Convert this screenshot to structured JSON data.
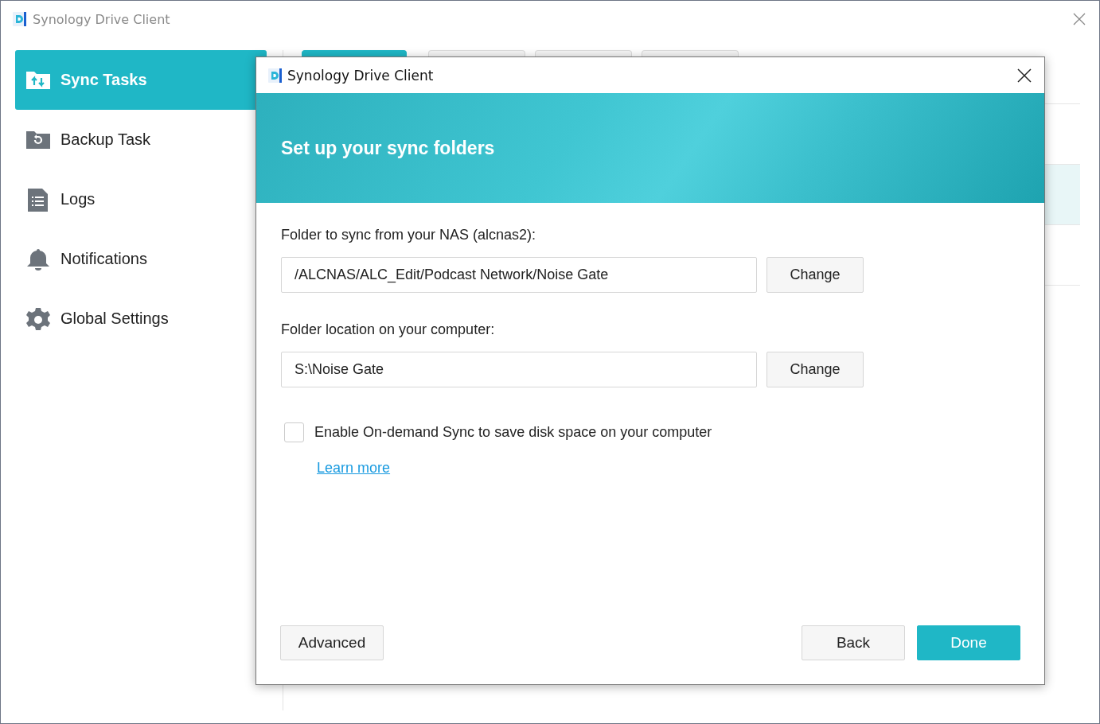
{
  "window": {
    "title": "Synology Drive Client"
  },
  "sidebar": {
    "items": [
      {
        "label": "Sync Tasks",
        "kind": "sync",
        "selected": true
      },
      {
        "label": "Backup Task",
        "kind": "backup",
        "selected": false
      },
      {
        "label": "Logs",
        "kind": "logs",
        "selected": false
      },
      {
        "label": "Notifications",
        "kind": "notifications",
        "selected": false
      },
      {
        "label": "Global Settings",
        "kind": "settings",
        "selected": false
      }
    ]
  },
  "background_tabs": [
    {
      "selected": true
    },
    {
      "selected": false
    },
    {
      "selected": false
    },
    {
      "selected": false
    }
  ],
  "background_rows": [
    {
      "selected": false
    },
    {
      "selected": true
    },
    {
      "selected": false
    }
  ],
  "dialog": {
    "title": "Synology Drive Client",
    "heading": "Set up your sync folders",
    "fields": [
      {
        "label": "Folder to sync from your NAS (alcnas2):",
        "value": "/ALCNAS/ALC_Edit/Podcast Network/Noise Gate",
        "button": "Change"
      },
      {
        "label": "Folder location on your computer:",
        "value": "S:\\Noise Gate",
        "button": "Change"
      }
    ],
    "on_demand": {
      "label": "Enable On-demand Sync to save disk space on your computer",
      "checked": false
    },
    "link": "Learn more",
    "buttons": [
      {
        "label": "Advanced",
        "kind": "secondary"
      },
      {
        "label": "Back",
        "kind": "secondary"
      },
      {
        "label": "Done",
        "kind": "primary"
      }
    ]
  }
}
